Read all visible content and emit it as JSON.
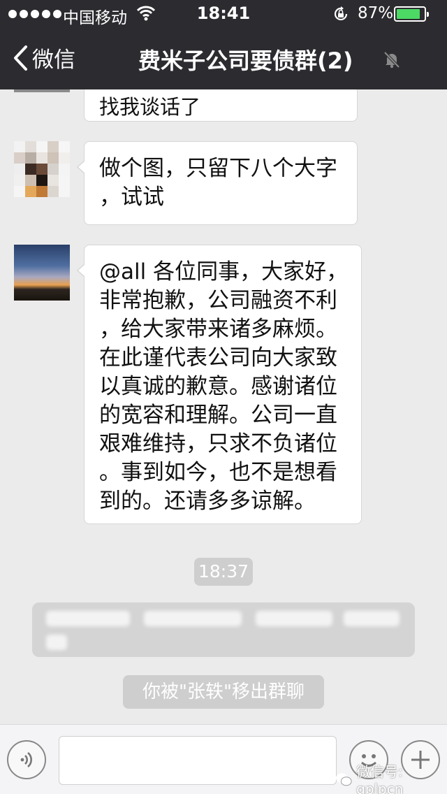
{
  "status_bar": {
    "carrier": "中国移动",
    "time": "18:41",
    "battery_percent": "87%",
    "battery_level": 0.87
  },
  "nav": {
    "back_label": "微信",
    "title": "费米子公司要债群(2)"
  },
  "messages": [
    {
      "text": "找我谈话了"
    },
    {
      "text": "做个图，只留下八个大字\n，试试"
    },
    {
      "text": "@all 各位同事，大家好，\n非常抱歉，公司融资不利\n，给大家带来诸多麻烦。\n在此谨代表公司向大家致\n以真诚的歉意。感谢诸位\n的宽容和理解。公司一直\n艰难维持，只求不负诸位\n。事到如今，也不是想看\n到的。还请多多谅解。"
    }
  ],
  "timestamp": "18:37",
  "system_notice": "你被\"张轶\"移出群聊",
  "watermark": "微信号: gplpcn",
  "colors": {
    "header_bg": "#2b2b30",
    "chat_bg": "#ebebeb",
    "battery_green": "#4cd964",
    "pill_bg": "#cecece"
  }
}
